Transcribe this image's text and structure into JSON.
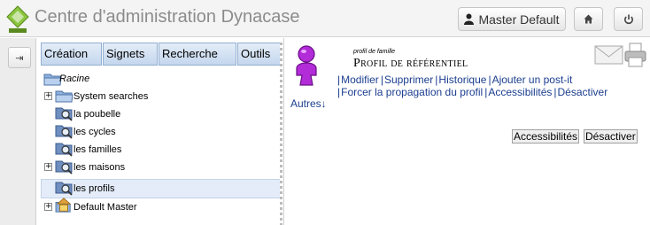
{
  "header": {
    "title": "Centre d'administration Dynacase",
    "user_label": "Master Default",
    "icons": [
      "dynacase-logo",
      "user-icon",
      "home-icon",
      "power-icon"
    ]
  },
  "strip": {
    "expand_label": "⇥"
  },
  "navigation": {
    "menu": [
      "Création",
      "Signets",
      "Recherche",
      "Outils"
    ],
    "tree": [
      {
        "label": "Racine",
        "icon": "folder-icon",
        "expandable": false
      },
      {
        "label": "System searches",
        "icon": "folder-icon",
        "expandable": true
      },
      {
        "label": "la poubelle",
        "icon": "search-folder-icon",
        "expandable": false
      },
      {
        "label": "les cycles",
        "icon": "search-folder-icon",
        "expandable": false
      },
      {
        "label": "les familles",
        "icon": "search-folder-icon",
        "expandable": false
      },
      {
        "label": "les maisons",
        "icon": "search-folder-icon",
        "expandable": true
      },
      {
        "label": "les profils",
        "icon": "search-folder-icon",
        "expandable": false,
        "selected": true
      },
      {
        "label": "Default Master",
        "icon": "home-folder-icon",
        "expandable": true
      }
    ]
  },
  "document": {
    "family_label": "profil de famille",
    "title": "Profil de référentiel",
    "icons": [
      "profile-person-icon",
      "mail-icon",
      "print-icon"
    ],
    "actions": [
      "Modifier",
      "Supprimer",
      "Historique",
      "Ajouter un post-it",
      "Forcer la propagation du profil",
      "Accessibilités",
      "Désactiver"
    ],
    "more_label": "Autres↓",
    "buttons": [
      "Accessibilités",
      "Désactiver"
    ]
  },
  "colors": {
    "accent": "#1b3e8f",
    "menu_bg": "#c5d7ee",
    "selected_bg": "#e3ecf8",
    "profile_icon": "#a020c8"
  }
}
